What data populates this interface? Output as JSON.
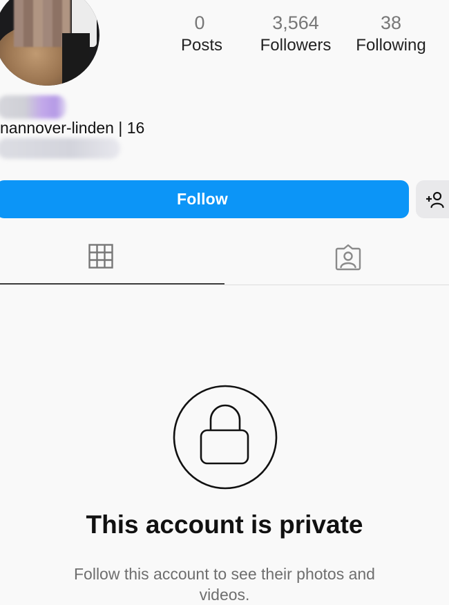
{
  "profile": {
    "stats": [
      {
        "key": "posts",
        "value": "0",
        "label": "Posts"
      },
      {
        "key": "followers",
        "value": "3,564",
        "label": "Followers"
      },
      {
        "key": "following",
        "value": "38",
        "label": "Following"
      }
    ],
    "bio_line": "nannover-linden | 16"
  },
  "actions": {
    "follow_label": "Follow",
    "suggest_icon": "add-person-icon",
    "accent_color": "#0c95f7"
  },
  "tabs": [
    {
      "name": "grid",
      "icon": "grid-icon",
      "active": true
    },
    {
      "name": "tagged",
      "icon": "tagged-person-icon",
      "active": false
    }
  ],
  "private_notice": {
    "icon": "lock-icon",
    "title": "This account is private",
    "subtitle": "Follow this account to see their photos and videos."
  }
}
